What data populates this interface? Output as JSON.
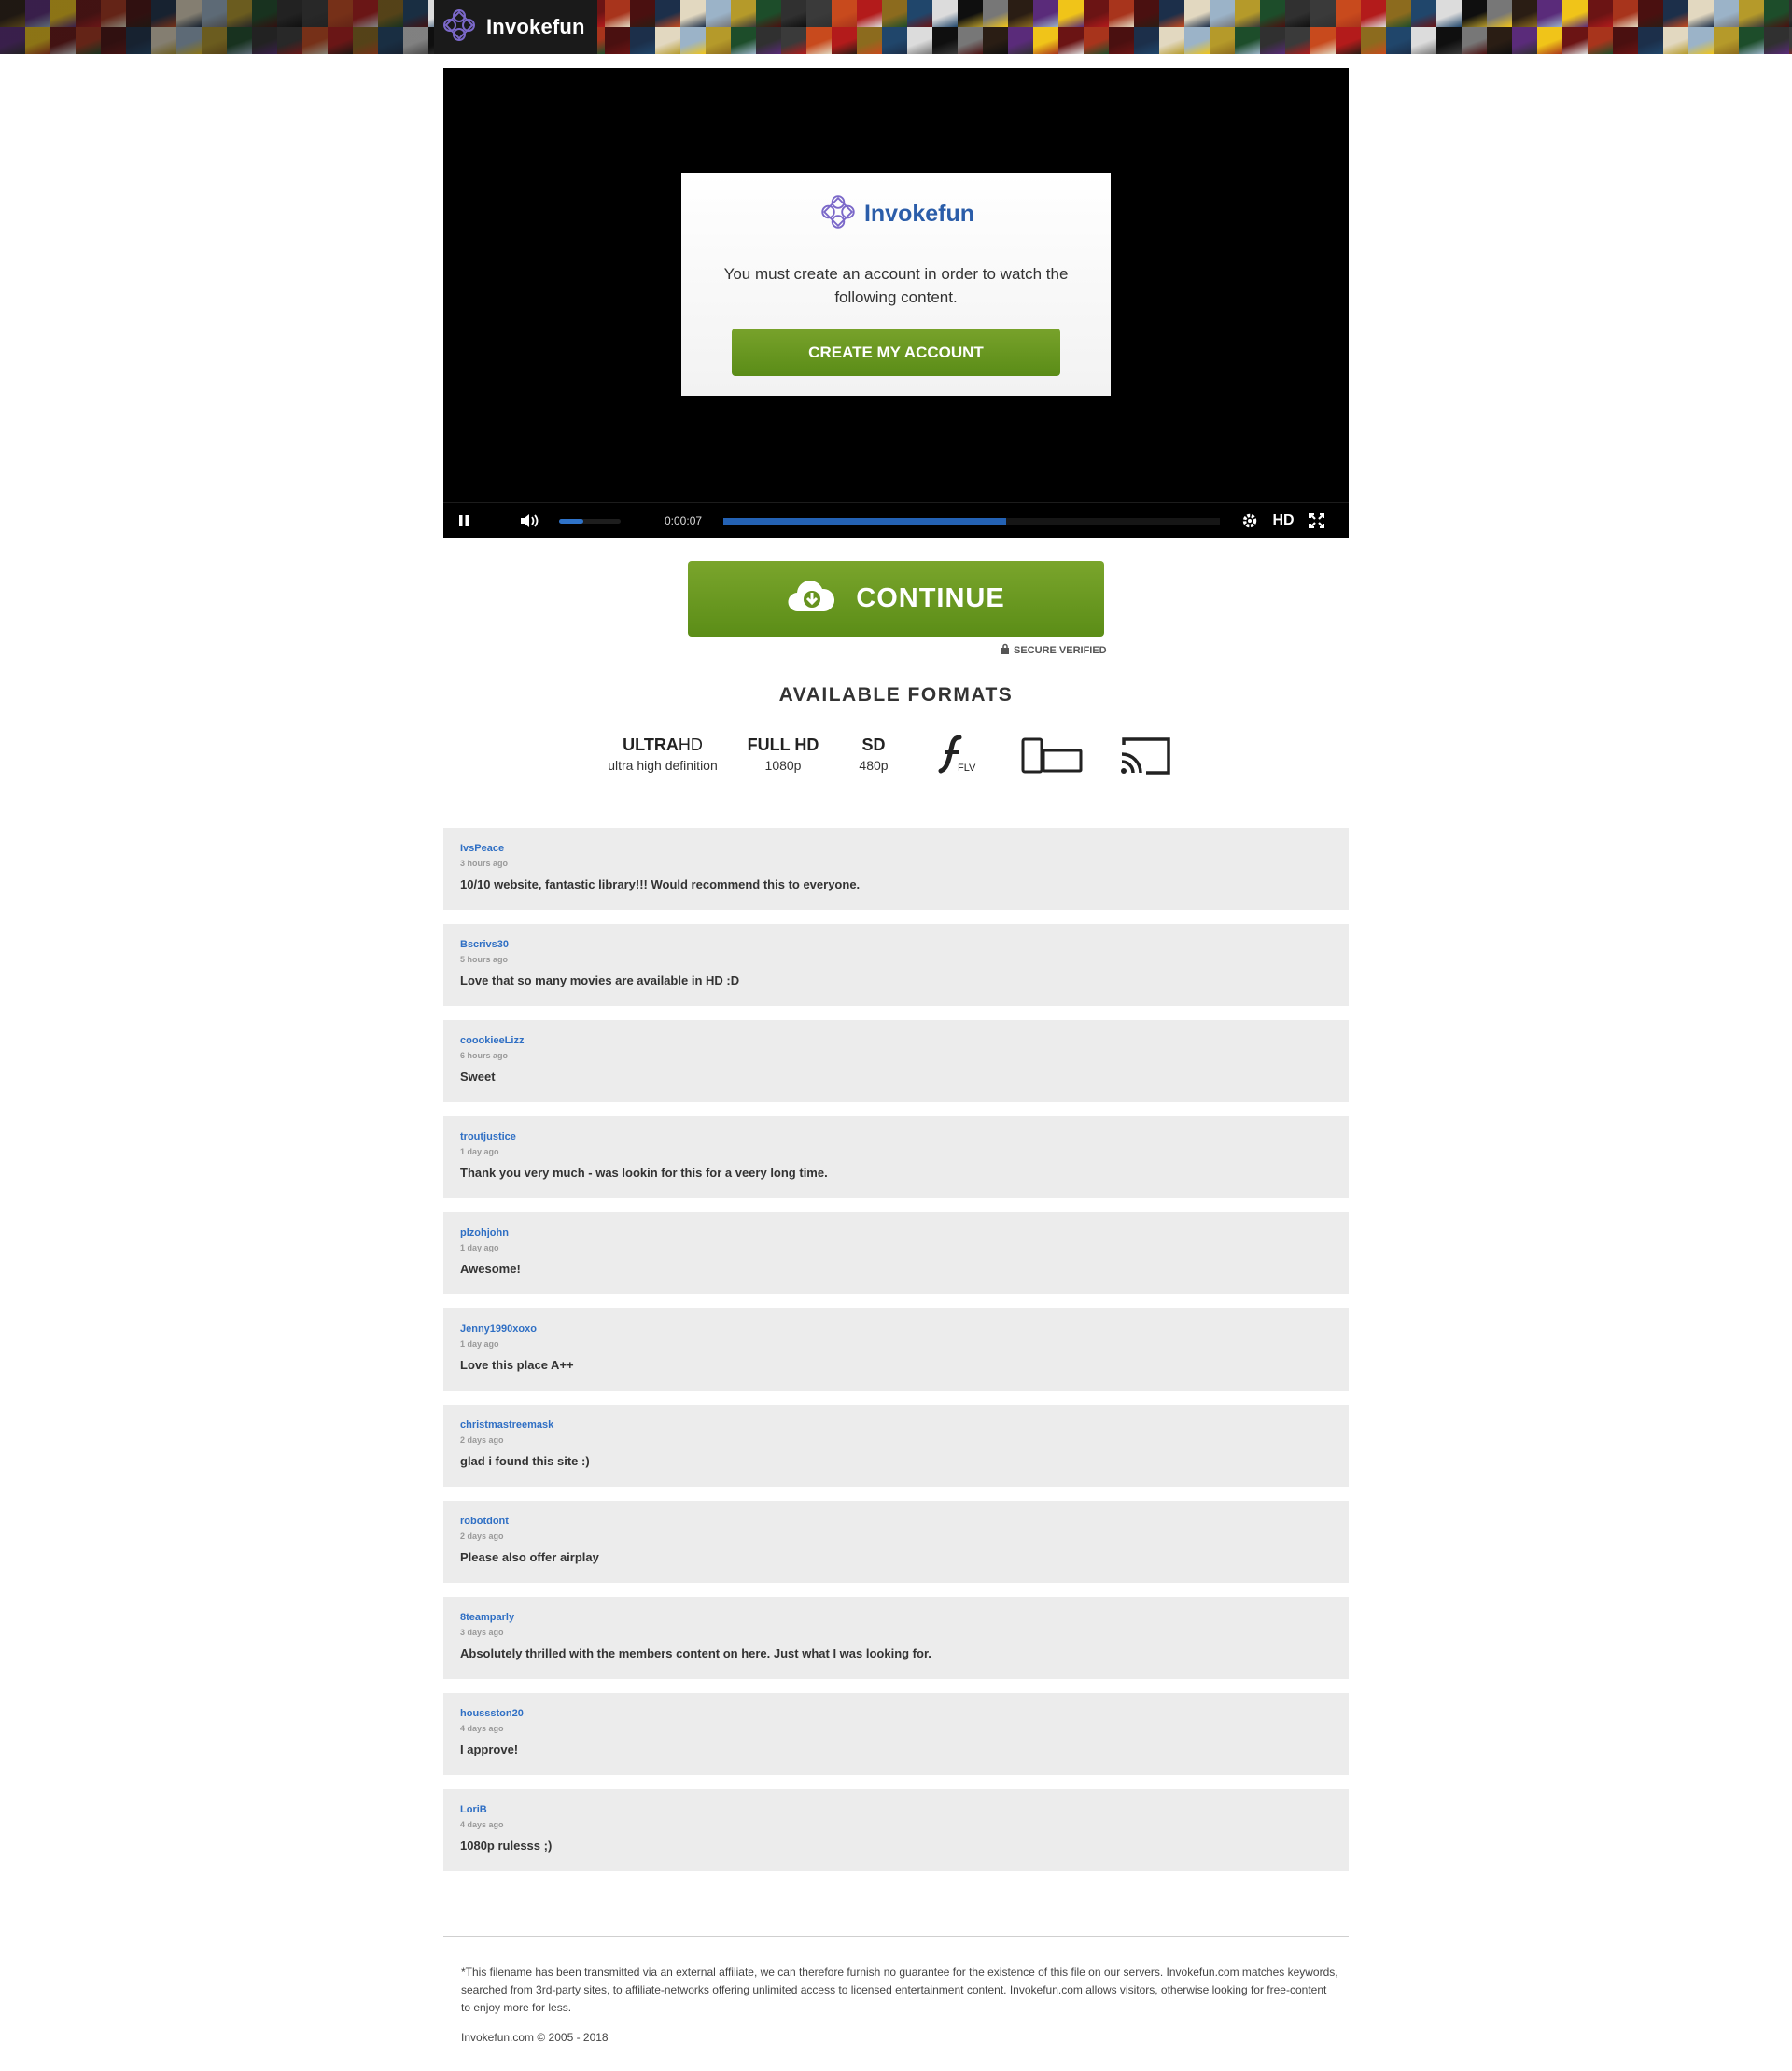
{
  "header": {
    "brand": "Invokefun",
    "tile_colors": [
      "#2a1d14",
      "#6b1414",
      "#1c2f4a",
      "#b59a2a",
      "#3a3a3a",
      "#8c6b1e",
      "#0f0f0f",
      "#5a2b7a",
      "#a8341c",
      "#e2d8c0",
      "#1d4d2a",
      "#c84a1d",
      "#20466b",
      "#777777",
      "#f0c419",
      "#4a1010",
      "#9bb3c8",
      "#303030",
      "#b31b1b",
      "#dcdcdc"
    ]
  },
  "modal": {
    "brand": "Invokefun",
    "message": "You must create an account in order to watch the following content.",
    "button": "CREATE MY ACCOUNT"
  },
  "player": {
    "time": "0:00:07",
    "progress": 0.57,
    "volume": 0.4,
    "hd_label": "HD",
    "icons": [
      "pause-icon",
      "volume-icon",
      "settings-icon",
      "fullscreen-icon"
    ]
  },
  "cta": {
    "continue": "CONTINUE",
    "secure": "SECURE VERIFIED"
  },
  "formats": {
    "title": "AVAILABLE FORMATS",
    "items": [
      {
        "main_bold": "ULTRA",
        "main_light": "HD",
        "sub": "ultra high definition"
      },
      {
        "main_bold": "FULL HD",
        "main_light": "",
        "sub": "1080p"
      },
      {
        "main_bold": "SD",
        "main_light": "",
        "sub": "480p"
      }
    ],
    "flv_label": "FLV",
    "icons": [
      "flash-flv-icon",
      "devices-icon",
      "cast-icon"
    ]
  },
  "comments": [
    {
      "user": "IvsPeace",
      "time": "3 hours ago",
      "text": "10/10 website, fantastic library!!! Would recommend this to everyone."
    },
    {
      "user": "Bscrivs30",
      "time": "5 hours ago",
      "text": "Love that so many movies are available in HD :D"
    },
    {
      "user": "coookieeLizz",
      "time": "6 hours ago",
      "text": "Sweet"
    },
    {
      "user": "troutjustice",
      "time": "1 day ago",
      "text": "Thank you very much - was lookin for this for a veery long time."
    },
    {
      "user": "plzohjohn",
      "time": "1 day ago",
      "text": "Awesome!"
    },
    {
      "user": "Jenny1990xoxo",
      "time": "1 day ago",
      "text": "Love this place A++"
    },
    {
      "user": "christmastreemask",
      "time": "2 days ago",
      "text": "glad i found this site :)"
    },
    {
      "user": "robotdont",
      "time": "2 days ago",
      "text": "Please also offer airplay"
    },
    {
      "user": "8teamparly",
      "time": "3 days ago",
      "text": "Absolutely thrilled with the members content on here. Just what I was looking for."
    },
    {
      "user": "houssston20",
      "time": "4 days ago",
      "text": "I approve!"
    },
    {
      "user": "LoriB",
      "time": "4 days ago",
      "text": "1080p rulesss ;)"
    }
  ],
  "footer": {
    "disclaimer": "*This filename has been transmitted via an external affiliate, we can therefore furnish no guarantee for the existence of this file on our servers. Invokefun.com matches keywords, searched from 3rd-party sites, to affiliate-networks offering unlimited access to licensed entertainment content. Invokefun.com allows visitors, otherwise looking for free-content to enjoy more for less.",
    "copyright": "Invokefun.com © 2005 - 2018"
  }
}
